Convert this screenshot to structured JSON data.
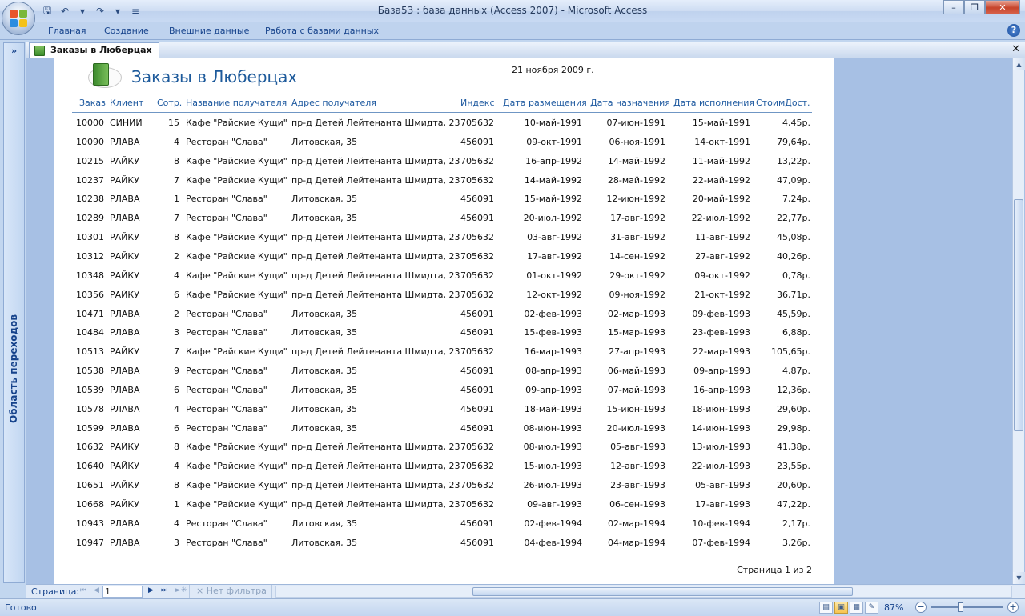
{
  "window": {
    "title": "База53 : база данных (Access 2007) - Microsoft Access"
  },
  "ribbon": {
    "tabs": [
      "Главная",
      "Создание",
      "Внешние данные",
      "Работа с базами данных"
    ]
  },
  "nav_pane": {
    "label": "Область переходов"
  },
  "document_tab": {
    "label": "Заказы в Люберцах"
  },
  "report": {
    "title": "Заказы в Люберцах",
    "date": "21 ноября 2009 г.",
    "headers": [
      "Заказ",
      "Клиент",
      "Сотр.",
      "Название получателя",
      "Адрес получателя",
      "Индекс",
      "Дата размещения",
      "Дата назначения",
      "Дата исполнения",
      "СтоимДост."
    ],
    "rows": [
      [
        "10000",
        "СИНИЙ",
        "15",
        "Кафе \"Райские Кущи\"",
        "пр-д Детей Лейтенанта Шмидта, 23",
        "705632",
        "10-май-1991",
        "07-июн-1991",
        "15-май-1991",
        "4,45р."
      ],
      [
        "10090",
        "РЛАВА",
        "4",
        "Ресторан \"Слава\"",
        "Литовская, 35",
        "456091",
        "09-окт-1991",
        "06-ноя-1991",
        "14-окт-1991",
        "79,64р."
      ],
      [
        "10215",
        "РАЙКУ",
        "8",
        "Кафе \"Райские Кущи\"",
        "пр-д Детей Лейтенанта Шмидта, 23",
        "705632",
        "16-апр-1992",
        "14-май-1992",
        "11-май-1992",
        "13,22р."
      ],
      [
        "10237",
        "РАЙКУ",
        "7",
        "Кафе \"Райские Кущи\"",
        "пр-д Детей Лейтенанта Шмидта, 23",
        "705632",
        "14-май-1992",
        "28-май-1992",
        "22-май-1992",
        "47,09р."
      ],
      [
        "10238",
        "РЛАВА",
        "1",
        "Ресторан \"Слава\"",
        "Литовская, 35",
        "456091",
        "15-май-1992",
        "12-июн-1992",
        "20-май-1992",
        "7,24р."
      ],
      [
        "10289",
        "РЛАВА",
        "7",
        "Ресторан \"Слава\"",
        "Литовская, 35",
        "456091",
        "20-июл-1992",
        "17-авг-1992",
        "22-июл-1992",
        "22,77р."
      ],
      [
        "10301",
        "РАЙКУ",
        "8",
        "Кафе \"Райские Кущи\"",
        "пр-д Детей Лейтенанта Шмидта, 23",
        "705632",
        "03-авг-1992",
        "31-авг-1992",
        "11-авг-1992",
        "45,08р."
      ],
      [
        "10312",
        "РАЙКУ",
        "2",
        "Кафе \"Райские Кущи\"",
        "пр-д Детей Лейтенанта Шмидта, 23",
        "705632",
        "17-авг-1992",
        "14-сен-1992",
        "27-авг-1992",
        "40,26р."
      ],
      [
        "10348",
        "РАЙКУ",
        "4",
        "Кафе \"Райские Кущи\"",
        "пр-д Детей Лейтенанта Шмидта, 23",
        "705632",
        "01-окт-1992",
        "29-окт-1992",
        "09-окт-1992",
        "0,78р."
      ],
      [
        "10356",
        "РАЙКУ",
        "6",
        "Кафе \"Райские Кущи\"",
        "пр-д Детей Лейтенанта Шмидта, 23",
        "705632",
        "12-окт-1992",
        "09-ноя-1992",
        "21-окт-1992",
        "36,71р."
      ],
      [
        "10471",
        "РЛАВА",
        "2",
        "Ресторан \"Слава\"",
        "Литовская, 35",
        "456091",
        "02-фев-1993",
        "02-мар-1993",
        "09-фев-1993",
        "45,59р."
      ],
      [
        "10484",
        "РЛАВА",
        "3",
        "Ресторан \"Слава\"",
        "Литовская, 35",
        "456091",
        "15-фев-1993",
        "15-мар-1993",
        "23-фев-1993",
        "6,88р."
      ],
      [
        "10513",
        "РАЙКУ",
        "7",
        "Кафе \"Райские Кущи\"",
        "пр-д Детей Лейтенанта Шмидта, 23",
        "705632",
        "16-мар-1993",
        "27-апр-1993",
        "22-мар-1993",
        "105,65р."
      ],
      [
        "10538",
        "РЛАВА",
        "9",
        "Ресторан \"Слава\"",
        "Литовская, 35",
        "456091",
        "08-апр-1993",
        "06-май-1993",
        "09-апр-1993",
        "4,87р."
      ],
      [
        "10539",
        "РЛАВА",
        "6",
        "Ресторан \"Слава\"",
        "Литовская, 35",
        "456091",
        "09-апр-1993",
        "07-май-1993",
        "16-апр-1993",
        "12,36р."
      ],
      [
        "10578",
        "РЛАВА",
        "4",
        "Ресторан \"Слава\"",
        "Литовская, 35",
        "456091",
        "18-май-1993",
        "15-июн-1993",
        "18-июн-1993",
        "29,60р."
      ],
      [
        "10599",
        "РЛАВА",
        "6",
        "Ресторан \"Слава\"",
        "Литовская, 35",
        "456091",
        "08-июн-1993",
        "20-июл-1993",
        "14-июн-1993",
        "29,98р."
      ],
      [
        "10632",
        "РАЙКУ",
        "8",
        "Кафе \"Райские Кущи\"",
        "пр-д Детей Лейтенанта Шмидта, 23",
        "705632",
        "08-июл-1993",
        "05-авг-1993",
        "13-июл-1993",
        "41,38р."
      ],
      [
        "10640",
        "РАЙКУ",
        "4",
        "Кафе \"Райские Кущи\"",
        "пр-д Детей Лейтенанта Шмидта, 23",
        "705632",
        "15-июл-1993",
        "12-авг-1993",
        "22-июл-1993",
        "23,55р."
      ],
      [
        "10651",
        "РАЙКУ",
        "8",
        "Кафе \"Райские Кущи\"",
        "пр-д Детей Лейтенанта Шмидта, 23",
        "705632",
        "26-июл-1993",
        "23-авг-1993",
        "05-авг-1993",
        "20,60р."
      ],
      [
        "10668",
        "РАЙКУ",
        "1",
        "Кафе \"Райские Кущи\"",
        "пр-д Детей Лейтенанта Шмидта, 23",
        "705632",
        "09-авг-1993",
        "06-сен-1993",
        "17-авг-1993",
        "47,22р."
      ],
      [
        "10943",
        "РЛАВА",
        "4",
        "Ресторан \"Слава\"",
        "Литовская, 35",
        "456091",
        "02-фев-1994",
        "02-мар-1994",
        "10-фев-1994",
        "2,17р."
      ],
      [
        "10947",
        "РЛАВА",
        "3",
        "Ресторан \"Слава\"",
        "Литовская, 35",
        "456091",
        "04-фев-1994",
        "04-мар-1994",
        "07-фев-1994",
        "3,26р."
      ]
    ],
    "footer": "Страница 1 из 2"
  },
  "record_nav": {
    "label": "Страница:",
    "current": "1",
    "filter_label": "Нет фильтра"
  },
  "status_bar": {
    "text": "Готово",
    "zoom": "87%"
  },
  "colors": {
    "accent": "#15428b",
    "report_title": "#1d5a9b",
    "header_text": "#1f5aa0",
    "ribbon_bg": "#bfd3ee"
  }
}
